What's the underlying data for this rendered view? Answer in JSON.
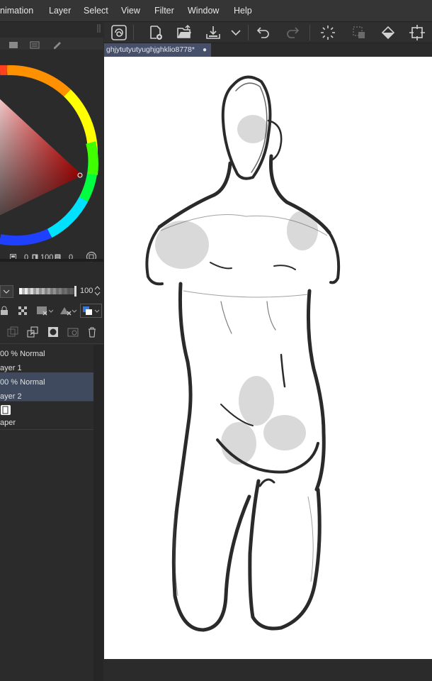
{
  "menubar": {
    "items": [
      {
        "label": "nimation"
      },
      {
        "label": "Layer"
      },
      {
        "label": "Select"
      },
      {
        "label": "View"
      },
      {
        "label": "Filter"
      },
      {
        "label": "Window"
      },
      {
        "label": "Help"
      }
    ]
  },
  "document": {
    "tab_title": "ghjytutyutyughjghklio8778*"
  },
  "color_panel": {
    "h_value": "0",
    "s_value": "100",
    "v_value": "0"
  },
  "layer_panel": {
    "opacity_value": "100",
    "layers": [
      {
        "blend": "00 % Normal",
        "name": "ayer 1",
        "selected": false
      },
      {
        "blend": "00 % Normal",
        "name": "ayer 2",
        "selected": true
      },
      {
        "blend": "",
        "name": "aper",
        "selected": false
      }
    ]
  },
  "colors": {
    "selected_layer": "#3f4a5e",
    "doc_tab": "#46506a",
    "canvas": "#ffffff"
  }
}
